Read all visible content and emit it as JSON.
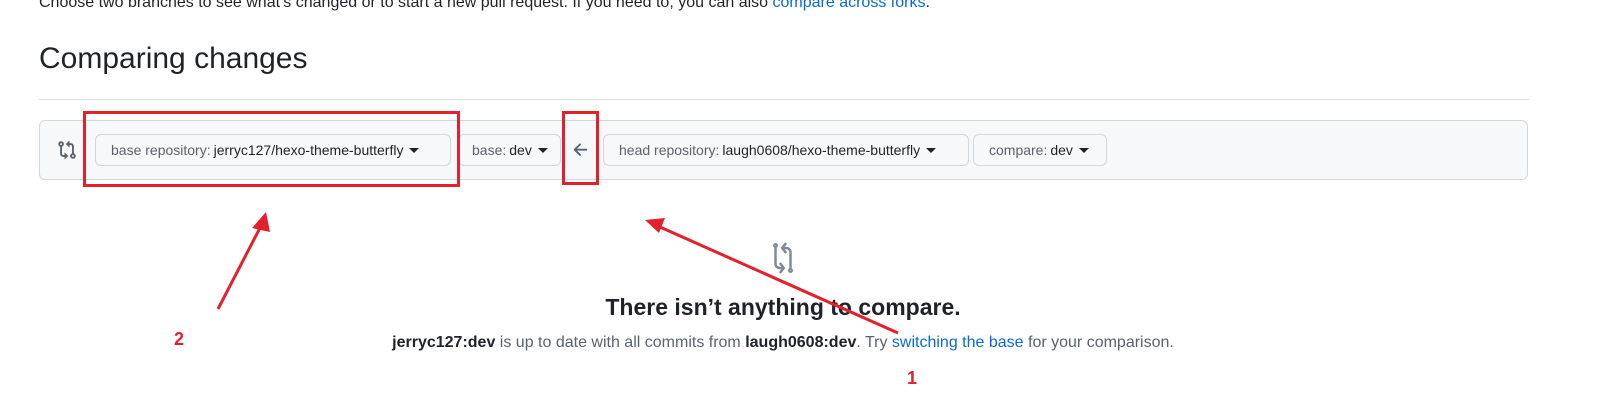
{
  "intro": {
    "text": "Choose two branches to see what’s changed or to start a new pull request. If you need to, you can also",
    "link": "compare across forks",
    "suffix": "."
  },
  "page_title": "Comparing changes",
  "range": {
    "base_repo": {
      "label": "base repository:",
      "value": "jerryc127/hexo-theme-butterfly"
    },
    "base_branch": {
      "label": "base:",
      "value": "dev"
    },
    "head_repo": {
      "label": "head repository:",
      "value": "laugh0608/hexo-theme-butterfly"
    },
    "compare_branch": {
      "label": "compare:",
      "value": "dev"
    }
  },
  "blankslate": {
    "title": "There isn’t anything to compare.",
    "desc_base": "jerryc127:dev",
    "desc_mid": " is up to date with all commits from ",
    "desc_head": "laugh0608:dev",
    "desc_try": ". Try ",
    "desc_link": "switching the base",
    "desc_end": " for your comparison."
  },
  "annotations": {
    "label_1": "1",
    "label_2": "2",
    "color": "#e3212d"
  },
  "colors": {
    "link": "#0969da",
    "text": "#1f2328",
    "muted": "#59636e",
    "border": "#d0d7de"
  }
}
